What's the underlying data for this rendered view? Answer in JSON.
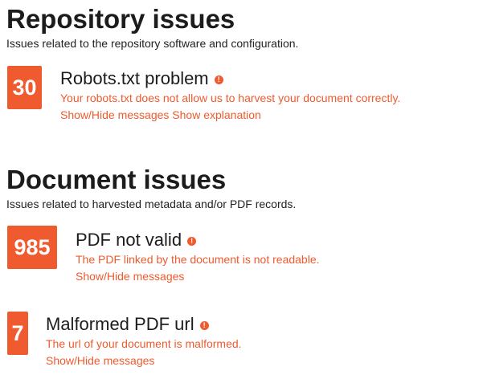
{
  "repository_section": {
    "title": "Repository issues",
    "description": "Issues related to the repository software and configuration.",
    "issues": [
      {
        "count": "30",
        "title": "Robots.txt problem",
        "message": "Your robots.txt does not allow us to harvest your document correctly.",
        "show_hide_label": "Show/Hide messages",
        "explanation_label": "Show explanation"
      }
    ]
  },
  "document_section": {
    "title": "Document issues",
    "description": "Issues related to harvested metadata and/or PDF records.",
    "issues": [
      {
        "count": "985",
        "title": "PDF not valid",
        "message": "The PDF linked by the document is not readable.",
        "show_hide_label": "Show/Hide messages"
      },
      {
        "count": "7",
        "title": "Malformed PDF url",
        "message": "The url of your document is malformed.",
        "show_hide_label": "Show/Hide messages"
      }
    ]
  },
  "colors": {
    "accent": "#ef5a2e",
    "heading": "#1c1c1c",
    "text": "#222222"
  },
  "icons": {
    "issue_warning": "exclamation-circle-icon"
  }
}
